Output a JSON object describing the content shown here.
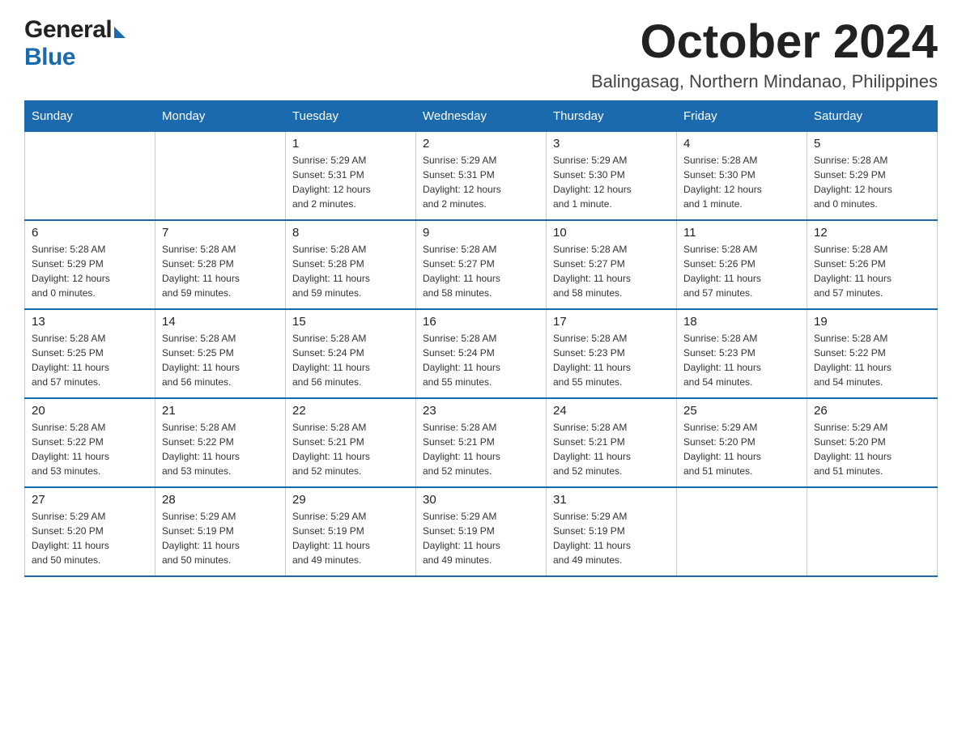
{
  "logo": {
    "general": "General",
    "blue": "Blue"
  },
  "title": "October 2024",
  "subtitle": "Balingasag, Northern Mindanao, Philippines",
  "days_of_week": [
    "Sunday",
    "Monday",
    "Tuesday",
    "Wednesday",
    "Thursday",
    "Friday",
    "Saturday"
  ],
  "weeks": [
    [
      {
        "day": "",
        "info": ""
      },
      {
        "day": "",
        "info": ""
      },
      {
        "day": "1",
        "info": "Sunrise: 5:29 AM\nSunset: 5:31 PM\nDaylight: 12 hours\nand 2 minutes."
      },
      {
        "day": "2",
        "info": "Sunrise: 5:29 AM\nSunset: 5:31 PM\nDaylight: 12 hours\nand 2 minutes."
      },
      {
        "day": "3",
        "info": "Sunrise: 5:29 AM\nSunset: 5:30 PM\nDaylight: 12 hours\nand 1 minute."
      },
      {
        "day": "4",
        "info": "Sunrise: 5:28 AM\nSunset: 5:30 PM\nDaylight: 12 hours\nand 1 minute."
      },
      {
        "day": "5",
        "info": "Sunrise: 5:28 AM\nSunset: 5:29 PM\nDaylight: 12 hours\nand 0 minutes."
      }
    ],
    [
      {
        "day": "6",
        "info": "Sunrise: 5:28 AM\nSunset: 5:29 PM\nDaylight: 12 hours\nand 0 minutes."
      },
      {
        "day": "7",
        "info": "Sunrise: 5:28 AM\nSunset: 5:28 PM\nDaylight: 11 hours\nand 59 minutes."
      },
      {
        "day": "8",
        "info": "Sunrise: 5:28 AM\nSunset: 5:28 PM\nDaylight: 11 hours\nand 59 minutes."
      },
      {
        "day": "9",
        "info": "Sunrise: 5:28 AM\nSunset: 5:27 PM\nDaylight: 11 hours\nand 58 minutes."
      },
      {
        "day": "10",
        "info": "Sunrise: 5:28 AM\nSunset: 5:27 PM\nDaylight: 11 hours\nand 58 minutes."
      },
      {
        "day": "11",
        "info": "Sunrise: 5:28 AM\nSunset: 5:26 PM\nDaylight: 11 hours\nand 57 minutes."
      },
      {
        "day": "12",
        "info": "Sunrise: 5:28 AM\nSunset: 5:26 PM\nDaylight: 11 hours\nand 57 minutes."
      }
    ],
    [
      {
        "day": "13",
        "info": "Sunrise: 5:28 AM\nSunset: 5:25 PM\nDaylight: 11 hours\nand 57 minutes."
      },
      {
        "day": "14",
        "info": "Sunrise: 5:28 AM\nSunset: 5:25 PM\nDaylight: 11 hours\nand 56 minutes."
      },
      {
        "day": "15",
        "info": "Sunrise: 5:28 AM\nSunset: 5:24 PM\nDaylight: 11 hours\nand 56 minutes."
      },
      {
        "day": "16",
        "info": "Sunrise: 5:28 AM\nSunset: 5:24 PM\nDaylight: 11 hours\nand 55 minutes."
      },
      {
        "day": "17",
        "info": "Sunrise: 5:28 AM\nSunset: 5:23 PM\nDaylight: 11 hours\nand 55 minutes."
      },
      {
        "day": "18",
        "info": "Sunrise: 5:28 AM\nSunset: 5:23 PM\nDaylight: 11 hours\nand 54 minutes."
      },
      {
        "day": "19",
        "info": "Sunrise: 5:28 AM\nSunset: 5:22 PM\nDaylight: 11 hours\nand 54 minutes."
      }
    ],
    [
      {
        "day": "20",
        "info": "Sunrise: 5:28 AM\nSunset: 5:22 PM\nDaylight: 11 hours\nand 53 minutes."
      },
      {
        "day": "21",
        "info": "Sunrise: 5:28 AM\nSunset: 5:22 PM\nDaylight: 11 hours\nand 53 minutes."
      },
      {
        "day": "22",
        "info": "Sunrise: 5:28 AM\nSunset: 5:21 PM\nDaylight: 11 hours\nand 52 minutes."
      },
      {
        "day": "23",
        "info": "Sunrise: 5:28 AM\nSunset: 5:21 PM\nDaylight: 11 hours\nand 52 minutes."
      },
      {
        "day": "24",
        "info": "Sunrise: 5:28 AM\nSunset: 5:21 PM\nDaylight: 11 hours\nand 52 minutes."
      },
      {
        "day": "25",
        "info": "Sunrise: 5:29 AM\nSunset: 5:20 PM\nDaylight: 11 hours\nand 51 minutes."
      },
      {
        "day": "26",
        "info": "Sunrise: 5:29 AM\nSunset: 5:20 PM\nDaylight: 11 hours\nand 51 minutes."
      }
    ],
    [
      {
        "day": "27",
        "info": "Sunrise: 5:29 AM\nSunset: 5:20 PM\nDaylight: 11 hours\nand 50 minutes."
      },
      {
        "day": "28",
        "info": "Sunrise: 5:29 AM\nSunset: 5:19 PM\nDaylight: 11 hours\nand 50 minutes."
      },
      {
        "day": "29",
        "info": "Sunrise: 5:29 AM\nSunset: 5:19 PM\nDaylight: 11 hours\nand 49 minutes."
      },
      {
        "day": "30",
        "info": "Sunrise: 5:29 AM\nSunset: 5:19 PM\nDaylight: 11 hours\nand 49 minutes."
      },
      {
        "day": "31",
        "info": "Sunrise: 5:29 AM\nSunset: 5:19 PM\nDaylight: 11 hours\nand 49 minutes."
      },
      {
        "day": "",
        "info": ""
      },
      {
        "day": "",
        "info": ""
      }
    ]
  ]
}
